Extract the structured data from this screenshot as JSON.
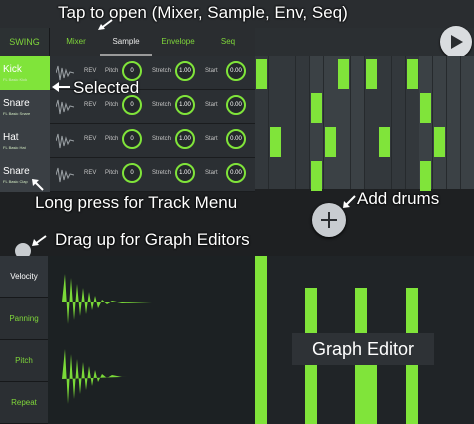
{
  "callouts": {
    "tap": "Tap to open (Mixer, Sample, Env, Seq)",
    "selected": "Selected",
    "long_press": "Long press for Track Menu",
    "add_drums": "Add drums",
    "drag_up": "Drag up for Graph Editors",
    "graph_editor": "Graph Editor"
  },
  "swing_label": "SWING",
  "tabs": [
    "Mixer",
    "Sample",
    "Envelope",
    "Seq"
  ],
  "active_tab": "Sample",
  "param_labels": {
    "rev": "REV",
    "pitch": "Pitch",
    "stretch": "Stretch",
    "start": "Start"
  },
  "tracks": [
    {
      "name": "Kick",
      "sub": "FL Basic Kick",
      "pitch": "0",
      "stretch": "1.00",
      "start": "0.00",
      "selected": true
    },
    {
      "name": "Snare",
      "sub": "FL Basic Snare",
      "pitch": "0",
      "stretch": "1.00",
      "start": "0.00",
      "selected": false
    },
    {
      "name": "Hat",
      "sub": "FL Basic Hat",
      "pitch": "0",
      "stretch": "1.00",
      "start": "0.00",
      "selected": false
    },
    {
      "name": "Snare",
      "sub": "FL Basic Clap",
      "pitch": "0",
      "stretch": "1.00",
      "start": "0.00",
      "selected": false
    }
  ],
  "graph_tabs": [
    "Velocity",
    "Panning",
    "Pitch",
    "Repeat"
  ],
  "active_graph_tab": "Velocity",
  "colors": {
    "accent": "#80e43a",
    "background": "#1e2022",
    "panel": "#2b2f33"
  },
  "icons": {
    "play": "play-icon",
    "add": "plus-icon",
    "drag": "drag-handle-icon"
  }
}
